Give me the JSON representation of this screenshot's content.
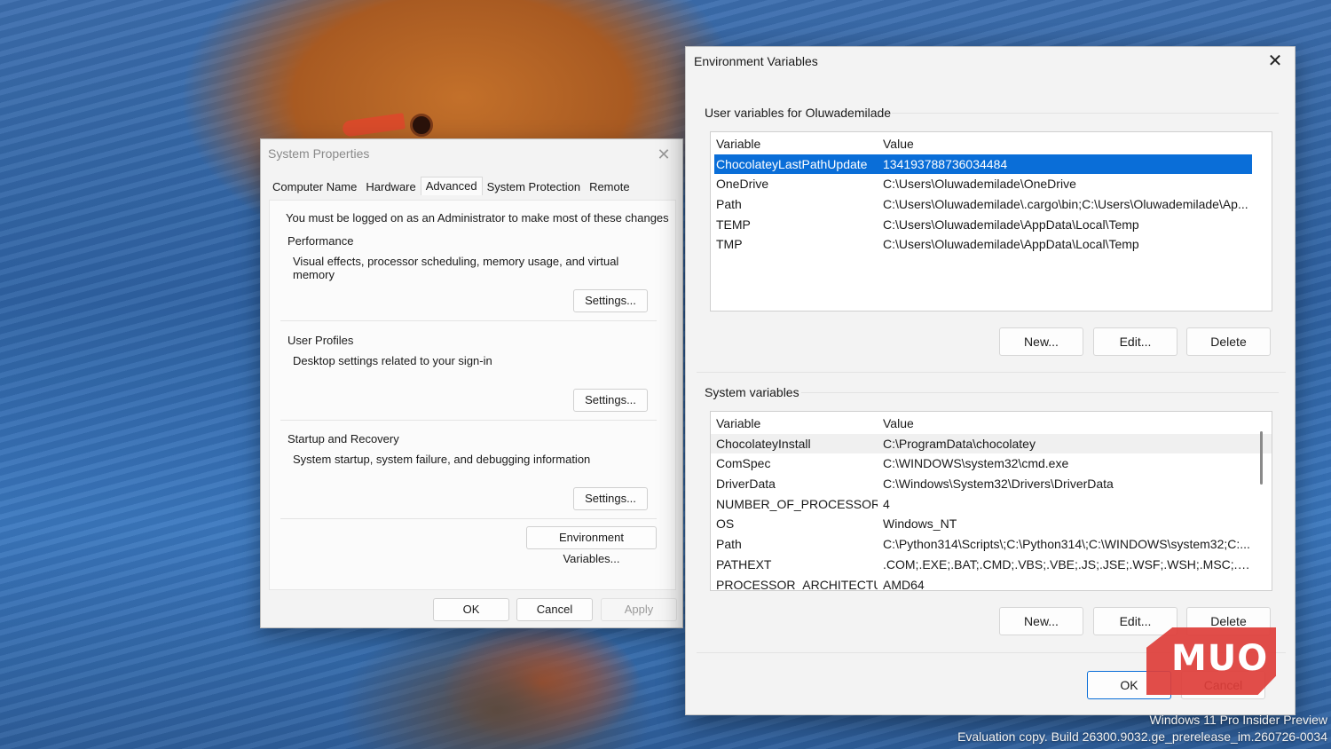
{
  "system_properties": {
    "title": "System Properties",
    "tabs": [
      "Computer Name",
      "Hardware",
      "Advanced",
      "System Protection",
      "Remote"
    ],
    "active_tab": "Advanced",
    "notice": "You must be logged on as an Administrator to make most of these changes",
    "groups": [
      {
        "title": "Performance",
        "description": "Visual effects, processor scheduling, memory usage, and virtual memory",
        "button": "Settings..."
      },
      {
        "title": "User Profiles",
        "description": "Desktop settings related to your sign-in",
        "button": "Settings..."
      },
      {
        "title": "Startup and Recovery",
        "description": "System startup, system failure, and debugging information",
        "button": "Settings..."
      }
    ],
    "env_button": "Environment Variables...",
    "ok": "OK",
    "cancel": "Cancel",
    "apply": "Apply"
  },
  "environment_variables": {
    "title": "Environment Variables",
    "user_section": {
      "title": "User variables for Oluwademilade",
      "columns": [
        "Variable",
        "Value"
      ],
      "rows": [
        {
          "variable": "ChocolateyLastPathUpdate",
          "value": "134193788736034484"
        },
        {
          "variable": "OneDrive",
          "value": "C:\\Users\\Oluwademilade\\OneDrive"
        },
        {
          "variable": "Path",
          "value": "C:\\Users\\Oluwademilade\\.cargo\\bin;C:\\Users\\Oluwademilade\\Ap..."
        },
        {
          "variable": "TEMP",
          "value": "C:\\Users\\Oluwademilade\\AppData\\Local\\Temp"
        },
        {
          "variable": "TMP",
          "value": "C:\\Users\\Oluwademilade\\AppData\\Local\\Temp"
        }
      ],
      "selected_row": 0,
      "buttons": [
        "New...",
        "Edit...",
        "Delete"
      ]
    },
    "system_section": {
      "title": "System variables",
      "columns": [
        "Variable",
        "Value"
      ],
      "rows": [
        {
          "variable": "ChocolateyInstall",
          "value": "C:\\ProgramData\\chocolatey"
        },
        {
          "variable": "ComSpec",
          "value": "C:\\WINDOWS\\system32\\cmd.exe"
        },
        {
          "variable": "DriverData",
          "value": "C:\\Windows\\System32\\Drivers\\DriverData"
        },
        {
          "variable": "NUMBER_OF_PROCESSORS",
          "value": "4"
        },
        {
          "variable": "OS",
          "value": "Windows_NT"
        },
        {
          "variable": "Path",
          "value": "C:\\Python314\\Scripts\\;C:\\Python314\\;C:\\WINDOWS\\system32;C:..."
        },
        {
          "variable": "PATHEXT",
          "value": ".COM;.EXE;.BAT;.CMD;.VBS;.VBE;.JS;.JSE;.WSF;.WSH;.MSC;.PY;.PYW"
        },
        {
          "variable": "PROCESSOR_ARCHITECTURE",
          "value": "AMD64"
        }
      ],
      "buttons": [
        "New...",
        "Edit...",
        "Delete"
      ]
    },
    "ok": "OK",
    "cancel": "Cancel"
  },
  "watermark": {
    "line1": "Windows 11 Pro Insider Preview",
    "line2": "Evaluation copy. Build 26300.9032.ge_prerelease_im.260726-0034"
  },
  "logo_text": "MUO"
}
